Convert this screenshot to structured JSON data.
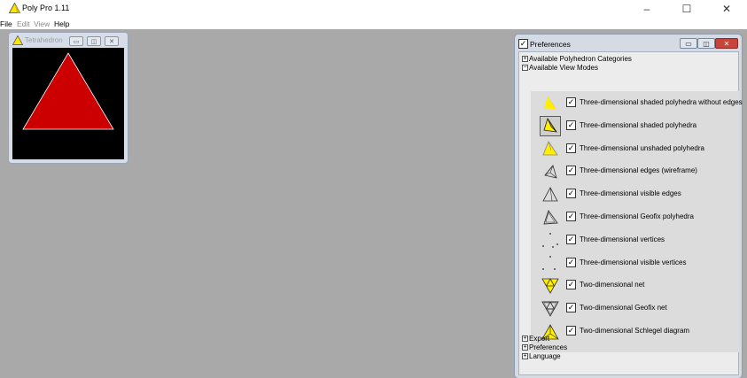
{
  "window": {
    "title": "Poly Pro 1.11",
    "minimize": "–",
    "maximize": "☐",
    "close": "✕"
  },
  "menu": [
    "File",
    "Edit",
    "View",
    "Help"
  ],
  "tetrahedron_window": {
    "title": "Tetrahedron",
    "shape_color": "#cc0000",
    "edge_color": "#ffffff",
    "background": "#000000"
  },
  "preferences": {
    "title": "Preferences",
    "tree": {
      "available_polyhedron_categories": "Available Polyhedron Categories",
      "available_view_modes": "Available View Modes",
      "export": "Export",
      "preferences": "Preferences",
      "language": "Language"
    },
    "view_modes": [
      {
        "label": "Three-dimensional shaded polyhedra without edges",
        "icon": "shaded-no-edges-icon",
        "checked": true,
        "selected": false
      },
      {
        "label": "Three-dimensional shaded polyhedra",
        "icon": "shaded-polyhedra-icon",
        "checked": true,
        "selected": true
      },
      {
        "label": "Three-dimensional unshaded polyhedra",
        "icon": "unshaded-polyhedra-icon",
        "checked": true,
        "selected": false
      },
      {
        "label": "Three-dimensional edges (wireframe)",
        "icon": "wireframe-icon",
        "checked": true,
        "selected": false
      },
      {
        "label": "Three-dimensional visible edges",
        "icon": "visible-edges-icon",
        "checked": true,
        "selected": false
      },
      {
        "label": "Three-dimensional Geofix polyhedra",
        "icon": "geofix-polyhedra-icon",
        "checked": true,
        "selected": false
      },
      {
        "label": "Three-dimensional vertices",
        "icon": "vertices-icon",
        "checked": true,
        "selected": false
      },
      {
        "label": "Three-dimensional visible vertices",
        "icon": "visible-vertices-icon",
        "checked": true,
        "selected": false
      },
      {
        "label": "Two-dimensional net",
        "icon": "net-icon",
        "checked": true,
        "selected": false
      },
      {
        "label": "Two-dimensional Geofix net",
        "icon": "geofix-net-icon",
        "checked": true,
        "selected": false
      },
      {
        "label": "Two-dimensional Schlegel diagram",
        "icon": "schlegel-diagram-icon",
        "checked": true,
        "selected": false
      }
    ]
  },
  "colors": {
    "workspace": "#a9a9a9",
    "accent_yellow": "#ffee00",
    "close_red": "#c9443b"
  }
}
